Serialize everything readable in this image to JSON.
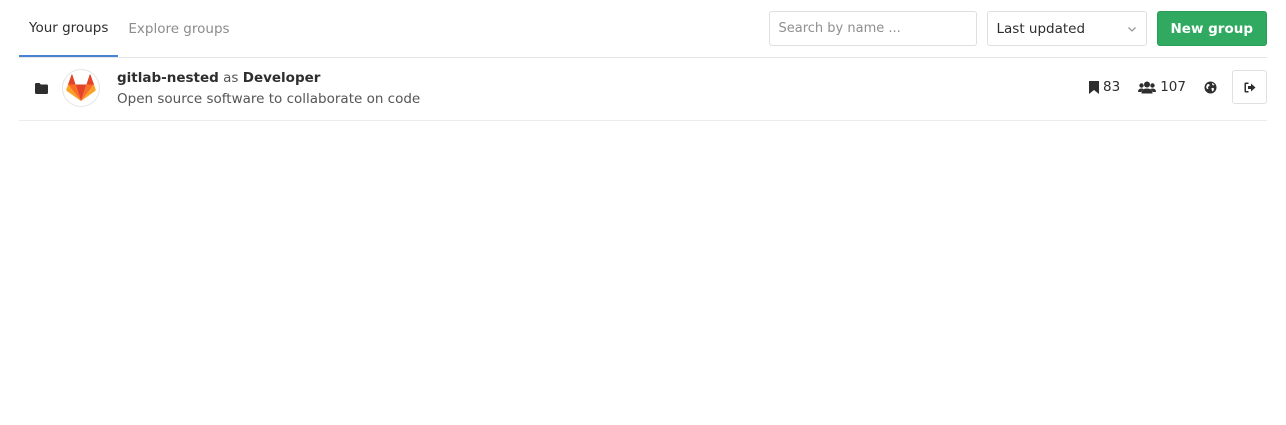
{
  "tabs": [
    {
      "label": "Your groups",
      "active": true
    },
    {
      "label": "Explore groups",
      "active": false
    }
  ],
  "search": {
    "placeholder": "Search by name ...",
    "value": ""
  },
  "sort": {
    "selected": "Last updated"
  },
  "new_group_button": {
    "label": "New group",
    "color": "#2faa60"
  },
  "groups": [
    {
      "name": "gitlab-nested",
      "as_text": "as",
      "role": "Developer",
      "description": "Open source software to collaborate on code",
      "projects_count": "83",
      "members_count": "107",
      "visibility_icon": "globe-icon",
      "avatar_icon": "gitlab-fox-logo",
      "type_icon": "folder-icon",
      "leave_icon": "leave-icon"
    }
  ],
  "colors": {
    "active_tab_underline": "#4a82d4",
    "fox_orange": "#e24329",
    "fox_light": "#fc6d26",
    "fox_yellow": "#fca326"
  }
}
